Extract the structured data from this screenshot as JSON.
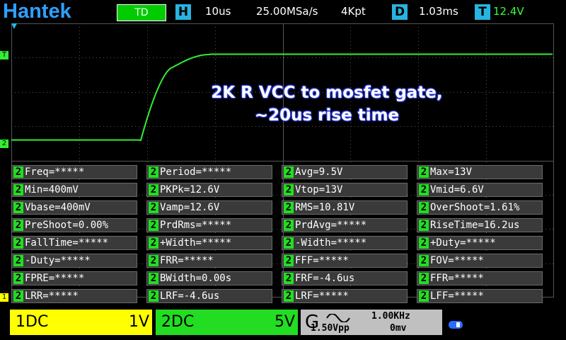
{
  "header": {
    "logo": "Hantek",
    "trigger_mode": "TD",
    "h_label": "H",
    "timebase": "10us",
    "sample_rate": "25.00MSa/s",
    "memory_depth": "4Kpt",
    "d_label": "D",
    "delay": "1.03ms",
    "t_label": "T",
    "trigger_level": "12.4V"
  },
  "markers": {
    "trigger": "T",
    "ch2": "2",
    "ch1": "1"
  },
  "annotation": {
    "line1": "2K R VCC to mosfet gate,",
    "line2": "~20us rise time"
  },
  "measurements": {
    "channel": "2",
    "rows": [
      [
        "Freq=*****",
        "Period=*****",
        "Avg=9.5V",
        "Max=13V"
      ],
      [
        "Min=400mV",
        "PKPk=12.6V",
        "Vtop=13V",
        "Vmid=6.6V"
      ],
      [
        "Vbase=400mV",
        "Vamp=12.6V",
        "RMS=10.81V",
        "OverShoot=1.61%"
      ],
      [
        "PreShoot=0.00%",
        "PrdRms=*****",
        "PrdAvg=*****",
        "RiseTime=16.2us"
      ],
      [
        "FallTime=*****",
        "+Width=*****",
        "-Width=*****",
        "+Duty=*****"
      ],
      [
        "-Duty=*****",
        "FRR=*****",
        "FFF=*****",
        "FOV=*****"
      ],
      [
        "FPRE=*****",
        "BWidth=0.00s",
        "FRF=-4.6us",
        "FFR=*****"
      ],
      [
        "LRR=*****",
        "LRF=-4.6us",
        "LRF=*****",
        "LFF=*****"
      ]
    ]
  },
  "channels": {
    "ch1": {
      "label": "1DC",
      "scale": "1V",
      "color": "#ffff00"
    },
    "ch2": {
      "label": "2DC",
      "scale": "5V",
      "color": "#22dd22"
    }
  },
  "generator": {
    "label": "G",
    "frequency": "1.00KHz",
    "amplitude": "1.50Vpp",
    "offset": "0mv"
  },
  "colors": {
    "grid": "#555555",
    "trace_ch2": "#33ee33",
    "accent_blue": "#28b4e0"
  },
  "icons": {
    "waveform": "sine-wave-icon",
    "usb": "usb-icon"
  }
}
